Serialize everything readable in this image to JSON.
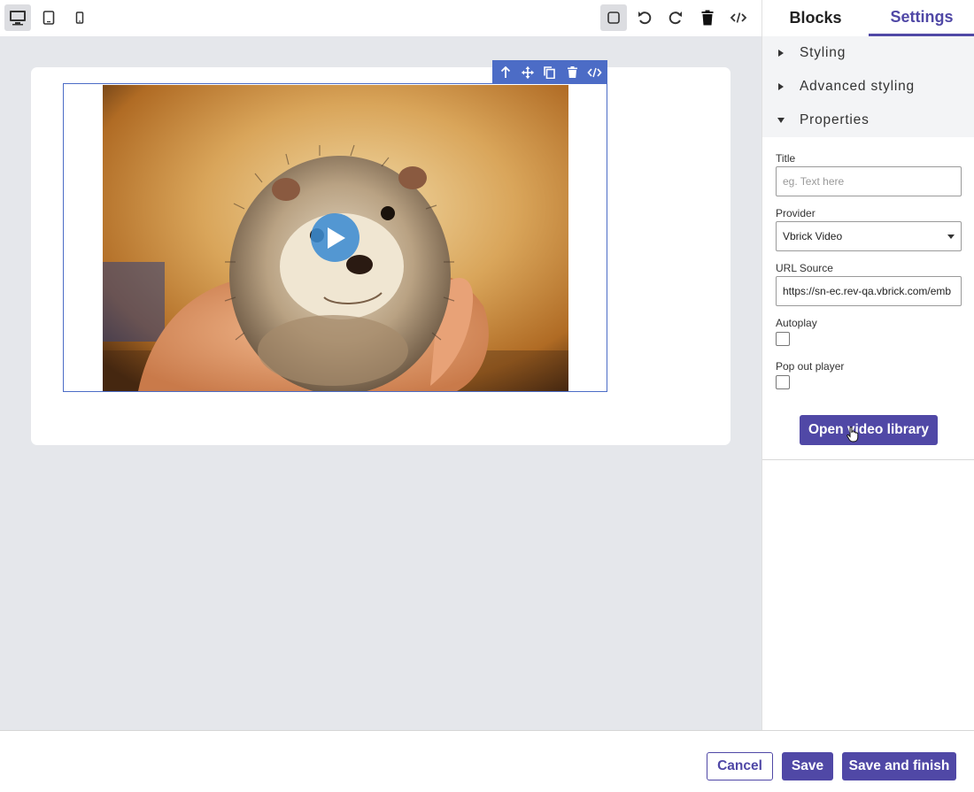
{
  "toolbar": {
    "device_desktop": "desktop-icon",
    "device_tablet": "tablet-icon",
    "device_mobile": "mobile-icon",
    "tools": [
      "select-outline-icon",
      "undo-icon",
      "redo-icon",
      "trash-icon",
      "code-icon"
    ]
  },
  "block_toolbar": {
    "icons": [
      "arrow-up-icon",
      "move-icon",
      "copy-icon",
      "trash-icon",
      "code-icon"
    ]
  },
  "panel": {
    "tabs": {
      "blocks": "Blocks",
      "settings": "Settings"
    },
    "sections": {
      "styling": "Styling",
      "advanced_styling": "Advanced styling",
      "properties": "Properties"
    },
    "properties": {
      "title_label": "Title",
      "title_placeholder": "eg. Text here",
      "title_value": "",
      "provider_label": "Provider",
      "provider_value": "Vbrick Video",
      "url_label": "URL Source",
      "url_value": "https://sn-ec.rev-qa.vbrick.com/emb",
      "autoplay_label": "Autoplay",
      "autoplay_checked": false,
      "popout_label": "Pop out player",
      "popout_checked": false,
      "open_library_label": "Open video library"
    }
  },
  "footer": {
    "cancel": "Cancel",
    "save": "Save",
    "save_finish": "Save and finish"
  },
  "colors": {
    "accent": "#5048a6",
    "selection": "#4c6cc6",
    "canvas_bg": "#e5e7eb"
  }
}
